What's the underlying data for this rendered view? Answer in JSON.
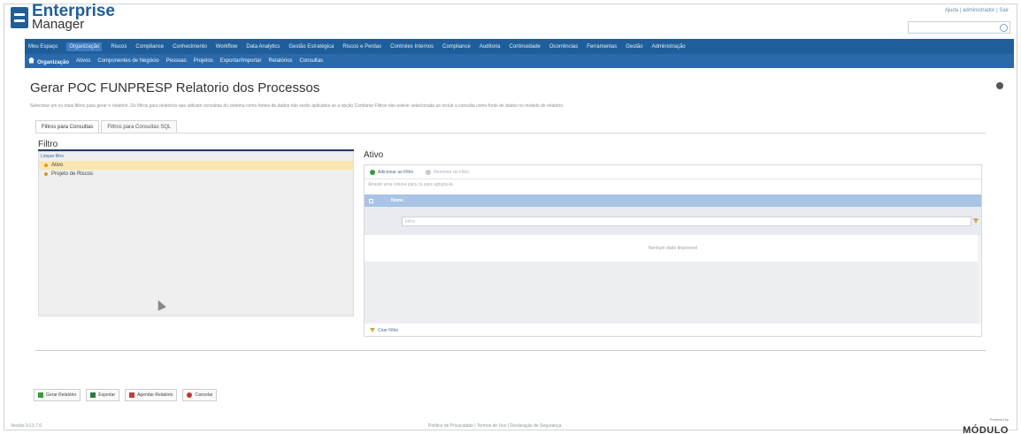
{
  "header": {
    "logo_line1": "Enterprise",
    "logo_line2": "Manager",
    "top_links": "Ajuda | administrador | Sair"
  },
  "menu1": [
    "Meu Espaço",
    "Organização",
    "Riscos",
    "Compliance",
    "Conhecimento",
    "Workflow",
    "Data Analytics",
    "Gestão Estratégica",
    "Riscos e Perdas",
    "Controles Internos",
    "Compliance",
    "Auditoria",
    "Continuidade",
    "Ocorrências",
    "Ferramentas",
    "Gestão",
    "Administração"
  ],
  "menu1_active": 1,
  "menu2": [
    "Organização",
    "Ativos",
    "Componentes de Negócio",
    "Pessoas",
    "Projetos",
    "Exportar/Importar",
    "Relatórios",
    "Consultas"
  ],
  "page": {
    "title": "Gerar POC FUNPRESP Relatorio dos Processos",
    "description": "Selecione um ou mais filtros para gerar o relatório. Os filtros para relatórios que utilizam consultas do sistema como fontes de dados não serão aplicados se a opção Combinar Filtros não estiver selecionada ao incluir a consulta como fonte de dados no modelo do relatório.",
    "tabs": [
      "Filtros para Consultas",
      "Filtros para Consultas SQL"
    ]
  },
  "filter_panel": {
    "title": "Filtro",
    "clear_link": "Limpar filtro",
    "items": [
      "Ativo",
      "Projeto de Riscos"
    ]
  },
  "ativo_panel": {
    "title": "Ativo",
    "add_label": "Adicionar ao Filtro",
    "remove_label": "Remover do Filtro",
    "hint": "Arraste uma coluna para cá para agrupá-la.",
    "column": "Nome",
    "filter_placeholder": "Filtro",
    "empty_text": "Nenhum dado disponível",
    "clear_filter": "Criar Filtro"
  },
  "actions": [
    "Gerar Relatório",
    "Exportar",
    "Agendar Relatório",
    "Cancelar"
  ],
  "footer": {
    "version": "Versão 9.13.7.0",
    "links": "Política de Privacidade | Termos de Uso | Declaração de Segurança",
    "powered_by": "Powered by",
    "brand": "MÓDULO"
  },
  "colors": {
    "menu_primary": "#1f5e9a",
    "menu_secondary": "#2a6aab",
    "selected_row": "#fbe6b0",
    "grid_header": "#a9c4e4"
  }
}
